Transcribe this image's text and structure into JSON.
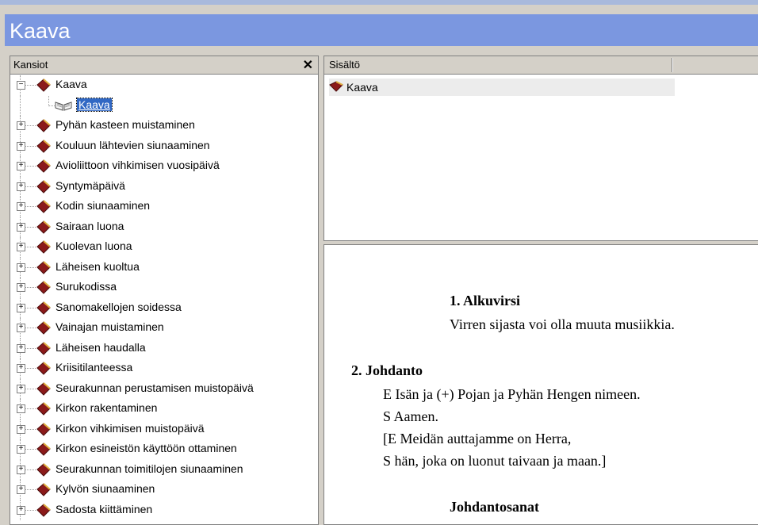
{
  "window": {
    "title": "Kaava"
  },
  "left_pane": {
    "header": "Kansiot",
    "close_symbol": "✕",
    "tree": {
      "root": {
        "label": "Kaava",
        "child": "Kaava"
      },
      "items": [
        "Pyhän kasteen muistaminen",
        "Kouluun lähtevien siunaaminen",
        "Avioliittoon vihkimisen vuosipäivä",
        "Syntymäpäivä",
        "Kodin siunaaminen",
        "Sairaan luona",
        "Kuolevan luona",
        "Läheisen kuoltua",
        "Surukodissa",
        "Sanomakellojen soidessa",
        "Vainajan muistaminen",
        "Läheisen haudalla",
        "Kriisitilanteessa",
        "Seurakunnan perustamisen muistopäivä",
        "Kirkon rakentaminen",
        "Kirkon vihkimisen muistopäivä",
        "Kirkon esineistön käyttöön ottaminen",
        "Seurakunnan toimitilojen siunaaminen",
        "Kylvön siunaaminen",
        "Sadosta kiittäminen"
      ]
    }
  },
  "content_pane": {
    "header": "Sisältö",
    "item": "Kaava"
  },
  "document": {
    "h1": "1. Alkuvirsi",
    "h1_note": "Virren sijasta voi olla muuta musiikkia.",
    "h2": "2. Johdanto",
    "lines": [
      "E Isän ja (+) Pojan ja Pyhän Hengen nimeen.",
      "S Aamen.",
      "[E Meidän auttajamme on Herra,",
      "S hän, joka on luonut taivaan ja maan.]"
    ],
    "h3": "Johdantosanat"
  },
  "colors": {
    "title_band": "#7b97e0",
    "selection": "#3168c4",
    "book": "#8b1a1a"
  }
}
